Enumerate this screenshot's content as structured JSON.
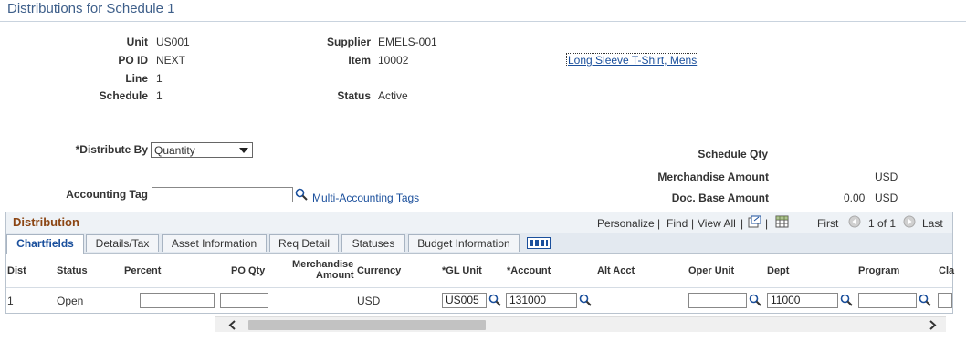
{
  "page": {
    "title": "Distributions for Schedule 1"
  },
  "header": {
    "unit_label": "Unit",
    "unit_value": "US001",
    "po_id_label": "PO ID",
    "po_id_value": "NEXT",
    "line_label": "Line",
    "line_value": "1",
    "schedule_label": "Schedule",
    "schedule_value": "1",
    "supplier_label": "Supplier",
    "supplier_value": "EMELS-001",
    "item_label": "Item",
    "item_value": "10002",
    "status_label": "Status",
    "status_value": "Active",
    "item_description": "Long Sleeve T-Shirt, Mens"
  },
  "form": {
    "distribute_by_label": "*Distribute By",
    "distribute_by_value": "Quantity",
    "accounting_tag_label": "Accounting Tag",
    "accounting_tag_value": "",
    "multi_accounting_tags_link": "Multi-Accounting Tags"
  },
  "amounts": {
    "schedule_qty_label": "Schedule Qty",
    "merchandise_amount_label": "Merchandise Amount",
    "merchandise_currency": "USD",
    "doc_base_amount_label": "Doc. Base Amount",
    "doc_base_amount_value": "0.00",
    "doc_base_currency": "USD"
  },
  "grid": {
    "title": "Distribution",
    "personalize": "Personalize",
    "find": "Find",
    "view_all": "View All",
    "sep": "|",
    "first": "First",
    "page_info": "1 of 1",
    "last": "Last",
    "tabs": [
      "Chartfields",
      "Details/Tax",
      "Asset Information",
      "Req Detail",
      "Statuses",
      "Budget Information"
    ],
    "columns": {
      "dist": "Dist",
      "status": "Status",
      "percent": "Percent",
      "po_qty": "PO Qty",
      "merchandise_amount_1": "Merchandise",
      "merchandise_amount_2": "Amount",
      "currency": "Currency",
      "gl_unit": "*GL Unit",
      "account": "*Account",
      "alt_acct": "Alt Acct",
      "oper_unit": "Oper Unit",
      "dept": "Dept",
      "program": "Program",
      "class": "Cla"
    },
    "row": {
      "dist": "1",
      "status": "Open",
      "percent": "",
      "po_qty": "",
      "currency": "USD",
      "gl_unit": "US005",
      "account": "131000",
      "oper_unit": "",
      "dept": "11000",
      "program": ""
    }
  },
  "colors": {
    "title": "#3e5f8a",
    "link": "#1a4f9c",
    "section": "#8b4513"
  }
}
